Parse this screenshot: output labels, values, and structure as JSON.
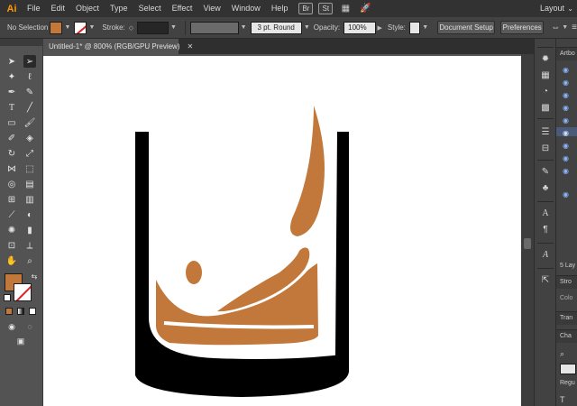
{
  "app": {
    "logo": "Ai"
  },
  "menu": {
    "items": [
      "File",
      "Edit",
      "Object",
      "Type",
      "Select",
      "Effect",
      "View",
      "Window",
      "Help"
    ],
    "bridge": "Br",
    "stock": "St",
    "layout_label": "Layout",
    "layout_chevron": "⌄"
  },
  "control": {
    "selection": "No Selection",
    "stroke_label": "Stroke:",
    "brush_value": "3 pt. Round",
    "opacity_label": "Opacity:",
    "opacity_value": "100%",
    "style_label": "Style:",
    "doc_setup": "Document Setup",
    "preferences": "Preferences"
  },
  "document": {
    "tab_title": "Untitled-1* @ 800% (RGB/GPU Preview)",
    "close_glyph": "✕"
  },
  "right_panel": {
    "artboards_label": "Artbo",
    "layers_label": "5 Lay",
    "stroke_label": "Stro",
    "color_label": "Colo",
    "transform_label": "Tran",
    "character_label": "Cha",
    "regular_label": "Regu"
  },
  "colors": {
    "fill": "#c2783a",
    "stroke": "#ffffff",
    "glass": "#000000",
    "liquid": "#c2783a",
    "accent_logo": "#ff9a00"
  },
  "icons": {
    "tools": [
      "selection",
      "direct-selection",
      "magic-wand",
      "lasso",
      "pen",
      "curvature",
      "type",
      "line",
      "rectangle",
      "paintbrush",
      "shaper",
      "eraser",
      "rotate",
      "scale",
      "width",
      "free-transform",
      "shape-builder",
      "perspective",
      "mesh",
      "gradient",
      "eyedropper",
      "blend",
      "symbol-sprayer",
      "column-graph",
      "artboard",
      "slice",
      "hand",
      "zoom"
    ]
  }
}
